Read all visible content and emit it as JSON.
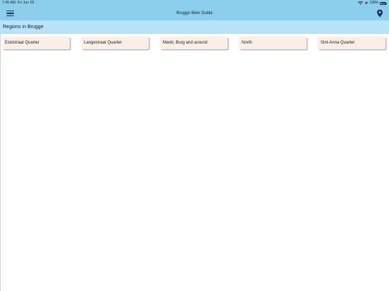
{
  "status_bar": {
    "time": "7:45 AM",
    "date": "Fri Jun 28",
    "battery_percent": "100%",
    "icons": [
      "wifi-icon",
      "location-arrow-icon",
      "battery-icon"
    ]
  },
  "nav": {
    "title": "Brugge Beer Guide",
    "menu_icon": "hamburger-menu-icon",
    "map_icon": "map-pin-icon",
    "accent_color": "#12305a",
    "bar_color": "#8ccfec"
  },
  "section": {
    "title": "Regions in Brugge",
    "header_color": "#b9e3f7"
  },
  "regions": [
    {
      "label": "Ezelstraat Quarter"
    },
    {
      "label": "Langestraat Quarter"
    },
    {
      "label": "Markt, Burg and around"
    },
    {
      "label": "North"
    },
    {
      "label": "Sint-Anna Quarter"
    }
  ],
  "card_color": "#f9efe6"
}
